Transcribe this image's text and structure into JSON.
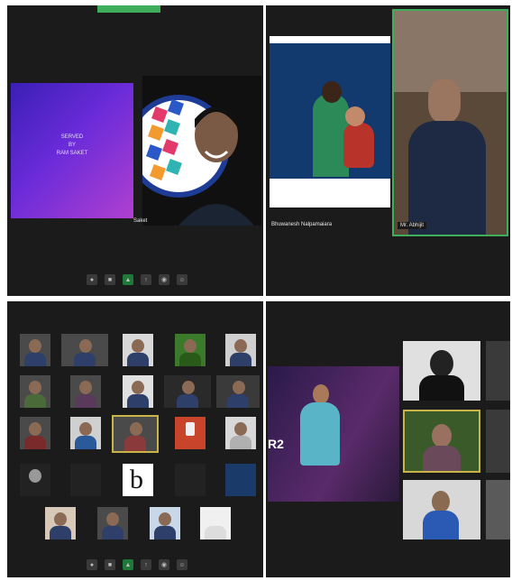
{
  "panels": {
    "top_left": {
      "slide_text": "SERVED\nBY\nRAM SAKET",
      "caption": "Saket"
    },
    "top_right": {
      "left_caption": "Bhuwanesh Nalpamaiara",
      "right_caption": "Mr. Abhijit"
    },
    "bottom_left": {
      "thumb_count": 26
    },
    "bottom_right": {
      "slide_label": "R2"
    }
  },
  "colors": {
    "dark_bg": "#1b1b1b",
    "highlight": "#3fae5a",
    "active_speaker": "#c9b44a",
    "slide_purple": "#6a2bd9"
  },
  "icons": [
    "mic-icon",
    "video-icon",
    "participants-icon",
    "share-icon",
    "record-icon",
    "reactions-icon"
  ]
}
